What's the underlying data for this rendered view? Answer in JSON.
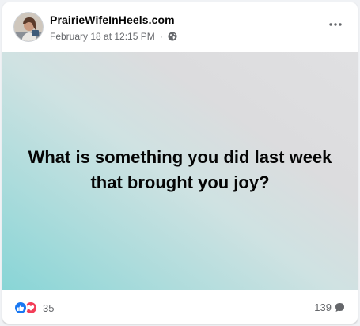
{
  "post": {
    "page_name": "PrairieWifeInHeels.com",
    "timestamp": "February 18 at 12:15 PM",
    "separator": "·",
    "privacy_icon": "globe-icon",
    "more_icon": "more-options-icon",
    "text": "What is something you did last week that brought you joy?"
  },
  "engagement": {
    "reaction_icons": [
      "like-icon",
      "love-icon"
    ],
    "reaction_count": "35",
    "comment_count": "139",
    "comment_icon": "comment-icon"
  },
  "colors": {
    "brand_blue": "#1877f2",
    "love_red": "#f33e58",
    "secondary_text": "#65676b",
    "gradient_start": "#88d5d6",
    "gradient_end": "#e0e0e2"
  }
}
